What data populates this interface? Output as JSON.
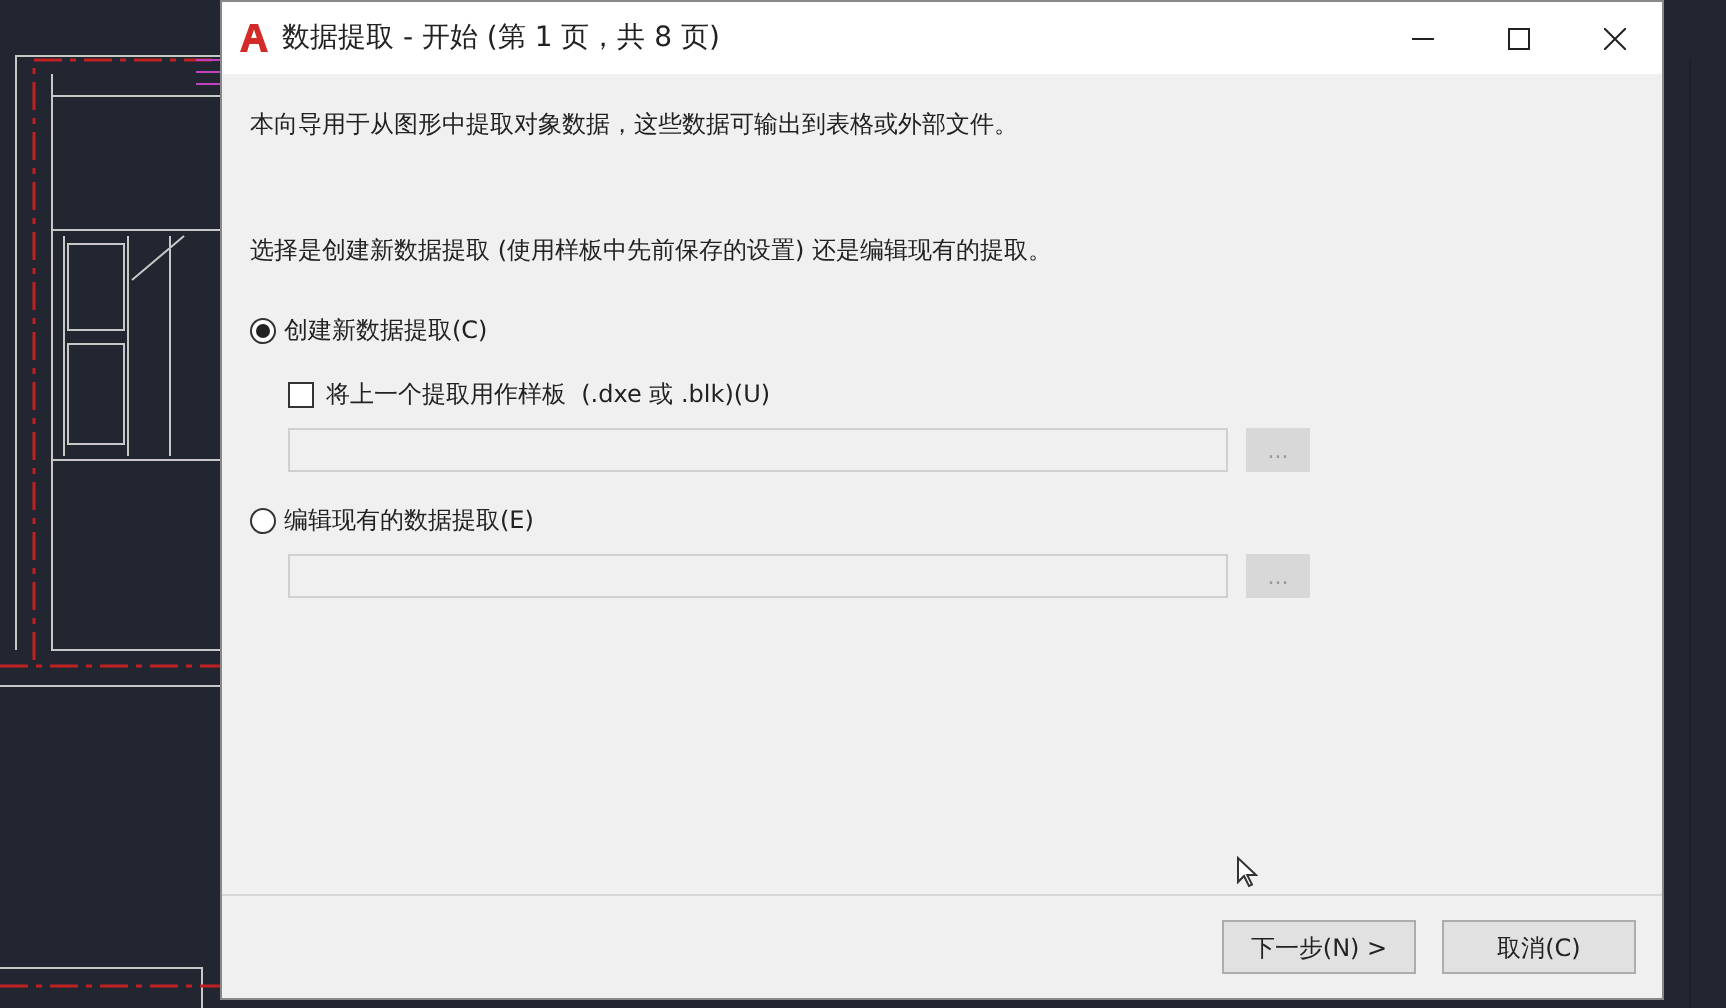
{
  "window": {
    "title": "数据提取 - 开始 (第 1 页，共 8 页)"
  },
  "intro": "本向导用于从图形中提取对象数据，这些数据可输出到表格或外部文件。",
  "prompt": "选择是创建新数据提取 (使用样板中先前保存的设置) 还是编辑现有的提取。",
  "options": [
    {
      "label": "创建新数据提取(C)",
      "selected": true,
      "checkbox": {
        "label": "将上一个提取用作样板  (.dxe 或 .blk)(U)",
        "checked": false
      },
      "field": {
        "disabled": true
      },
      "browse": "..."
    },
    {
      "label": "编辑现有的数据提取(E)",
      "selected": false,
      "field": {
        "disabled": true
      },
      "browse": "..."
    }
  ],
  "buttons": [
    {
      "label": "下一步(N) >"
    },
    {
      "label": "取消(C)"
    }
  ]
}
